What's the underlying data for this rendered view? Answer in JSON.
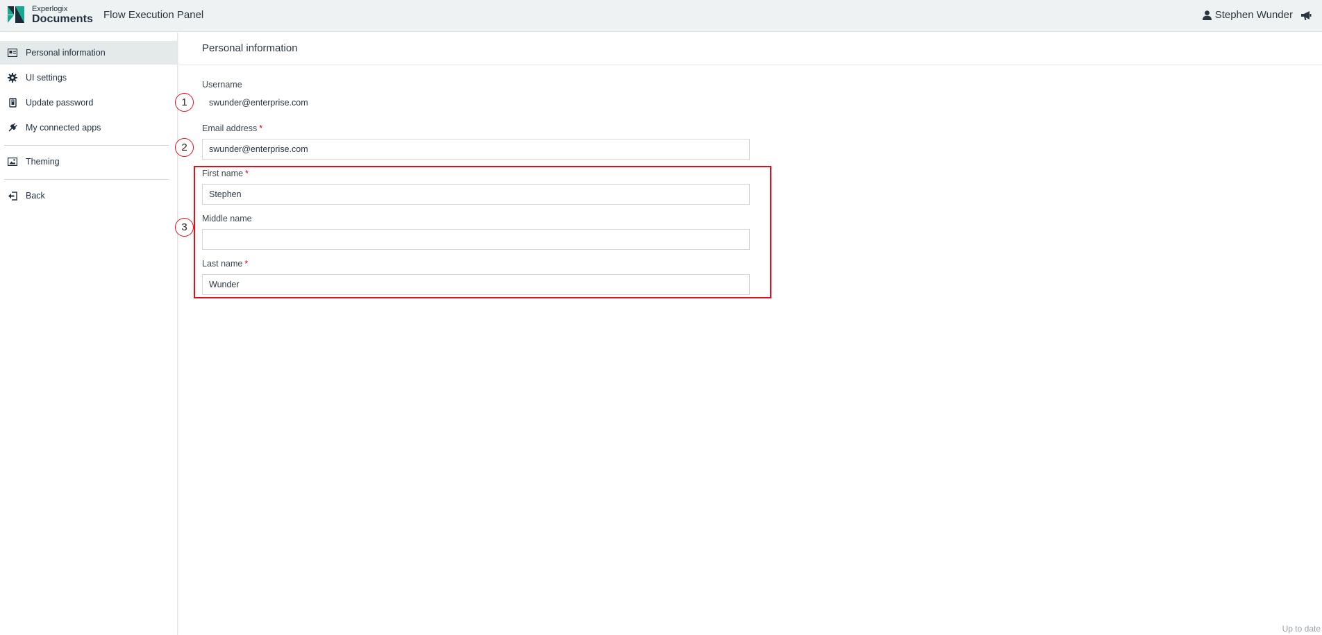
{
  "header": {
    "brand_small": "Experlogix",
    "brand_big": "Documents",
    "app_title": "Flow Execution Panel",
    "user_name": "Stephen Wunder",
    "icons": {
      "logo": "experlogix-logo",
      "user": "user-icon",
      "announce": "megaphone-icon"
    },
    "colors": {
      "logo_teal": "#16a98f",
      "logo_dark": "#1c2b39"
    }
  },
  "sidebar": {
    "items": [
      {
        "label": "Personal information",
        "icon": "id-card-icon",
        "active": true
      },
      {
        "label": "UI settings",
        "icon": "gear-icon",
        "active": false
      },
      {
        "label": "Update password",
        "icon": "lock-icon",
        "active": false
      },
      {
        "label": "My connected apps",
        "icon": "plug-icon",
        "active": false
      },
      {
        "label": "Theming",
        "icon": "image-icon",
        "active": false
      },
      {
        "label": "Back",
        "icon": "back-icon",
        "active": false
      }
    ]
  },
  "main": {
    "title": "Personal information",
    "username": {
      "label": "Username",
      "value": "swunder@enterprise.com"
    },
    "email": {
      "label": "Email address",
      "required_mark": "*",
      "value": "swunder@enterprise.com"
    },
    "first_name": {
      "label": "First name",
      "required_mark": "*",
      "value": "Stephen"
    },
    "middle_name": {
      "label": "Middle name",
      "value": ""
    },
    "last_name": {
      "label": "Last name",
      "required_mark": "*",
      "value": "Wunder"
    }
  },
  "annotations": {
    "callouts": [
      "1",
      "2",
      "3"
    ],
    "highlight_color": "#e0101a"
  },
  "footer": {
    "status": "Up to date"
  }
}
